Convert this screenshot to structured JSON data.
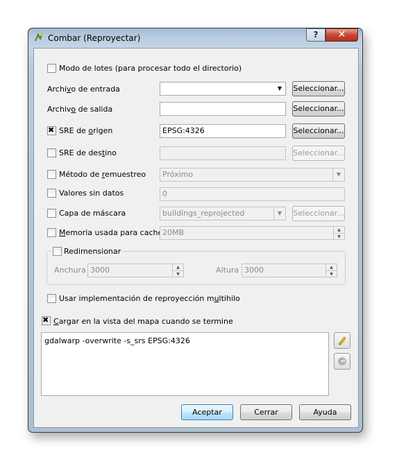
{
  "window": {
    "title": "Combar (Reproyectar)",
    "help_glyph": "?",
    "close_glyph": "✕"
  },
  "batch_mode": {
    "label": "Modo de lotes (para procesar todo el directorio)",
    "checked": false
  },
  "input_file": {
    "label_pre": "Archi",
    "label_acc": "v",
    "label_post": "o de entrada",
    "value": "",
    "button": "Seleccionar..."
  },
  "output_file": {
    "label_pre": "Archiv",
    "label_acc": "o",
    "label_post": " de salida",
    "value": "",
    "button": "Seleccionar..."
  },
  "source_srs": {
    "label_pre": "SRE de ",
    "label_acc": "o",
    "label_post": "rigen",
    "checked": true,
    "value": "EPSG:4326",
    "button": "Seleccionar..."
  },
  "target_srs": {
    "label_pre": "SRE de des",
    "label_acc": "t",
    "label_post": "ino",
    "checked": false,
    "value": "",
    "button": "Seleccionar..."
  },
  "resampling": {
    "label_pre": "Método de ",
    "label_acc": "r",
    "label_post": "emuestreo",
    "checked": false,
    "value": "Próximo"
  },
  "nodata": {
    "label": "Valores sin datos",
    "checked": false,
    "value": "0"
  },
  "mask_layer": {
    "label": "Capa de máscara",
    "checked": false,
    "value": "buildings_reprojected",
    "button": "Seleccionar..."
  },
  "cache": {
    "label_acc": "M",
    "label_post": "emoria usada para caché",
    "checked": false,
    "value": "20MB"
  },
  "resize": {
    "label": "Redimensionar",
    "checked": false,
    "width_label": "Anchura",
    "width_value": "3000",
    "height_label": "Altura",
    "height_value": "3000"
  },
  "multithread": {
    "label_pre": "Usar implementación de reproyección m",
    "label_acc": "u",
    "label_post": "ltihilo",
    "checked": false
  },
  "load_in_canvas": {
    "label_acc": "C",
    "label_post": "argar en la vista del mapa cuando se termine",
    "checked": true
  },
  "command": {
    "text": "gdalwarp -overwrite -s_srs EPSG:4326"
  },
  "icons": {
    "edit": "pencil-icon",
    "reset": "reset-icon"
  },
  "buttons": {
    "accept": "Aceptar",
    "close": "Cerrar",
    "help": "Ayuda"
  }
}
